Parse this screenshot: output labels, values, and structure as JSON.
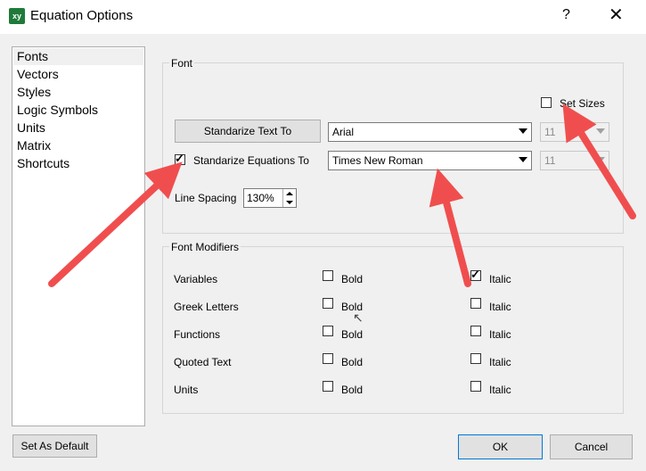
{
  "window": {
    "title": "Equation Options",
    "help_label": "?",
    "close_label": "✕",
    "app_icon": "xy"
  },
  "sidebar": {
    "items": [
      {
        "label": "Fonts",
        "selected": true
      },
      {
        "label": "Vectors"
      },
      {
        "label": "Styles"
      },
      {
        "label": "Logic Symbols"
      },
      {
        "label": "Units"
      },
      {
        "label": "Matrix"
      },
      {
        "label": "Shortcuts"
      }
    ]
  },
  "font_group": {
    "label": "Font",
    "set_sizes_label": "Set Sizes",
    "set_sizes_checked": false,
    "text_button_label": "Standarize Text To",
    "text_font": "Arial",
    "text_size": "11",
    "equations_label": "Standarize Equations To",
    "equations_checked": true,
    "equations_font": "Times New Roman",
    "equations_size": "11",
    "line_spacing_label": "Line Spacing",
    "line_spacing_value": "130%"
  },
  "modifiers_group": {
    "label": "Font Modifiers",
    "bold_label": "Bold",
    "italic_label": "Italic",
    "rows": [
      {
        "label": "Variables",
        "bold": false,
        "italic": true
      },
      {
        "label": "Greek Letters",
        "bold": false,
        "italic": false
      },
      {
        "label": "Functions",
        "bold": false,
        "italic": false
      },
      {
        "label": "Quoted Text",
        "bold": false,
        "italic": false
      },
      {
        "label": "Units",
        "bold": false,
        "italic": false
      }
    ]
  },
  "footer": {
    "default_label": "Set As Default",
    "ok_label": "OK",
    "cancel_label": "Cancel"
  },
  "annotations": {
    "arrow_color": "#f04e4e"
  }
}
